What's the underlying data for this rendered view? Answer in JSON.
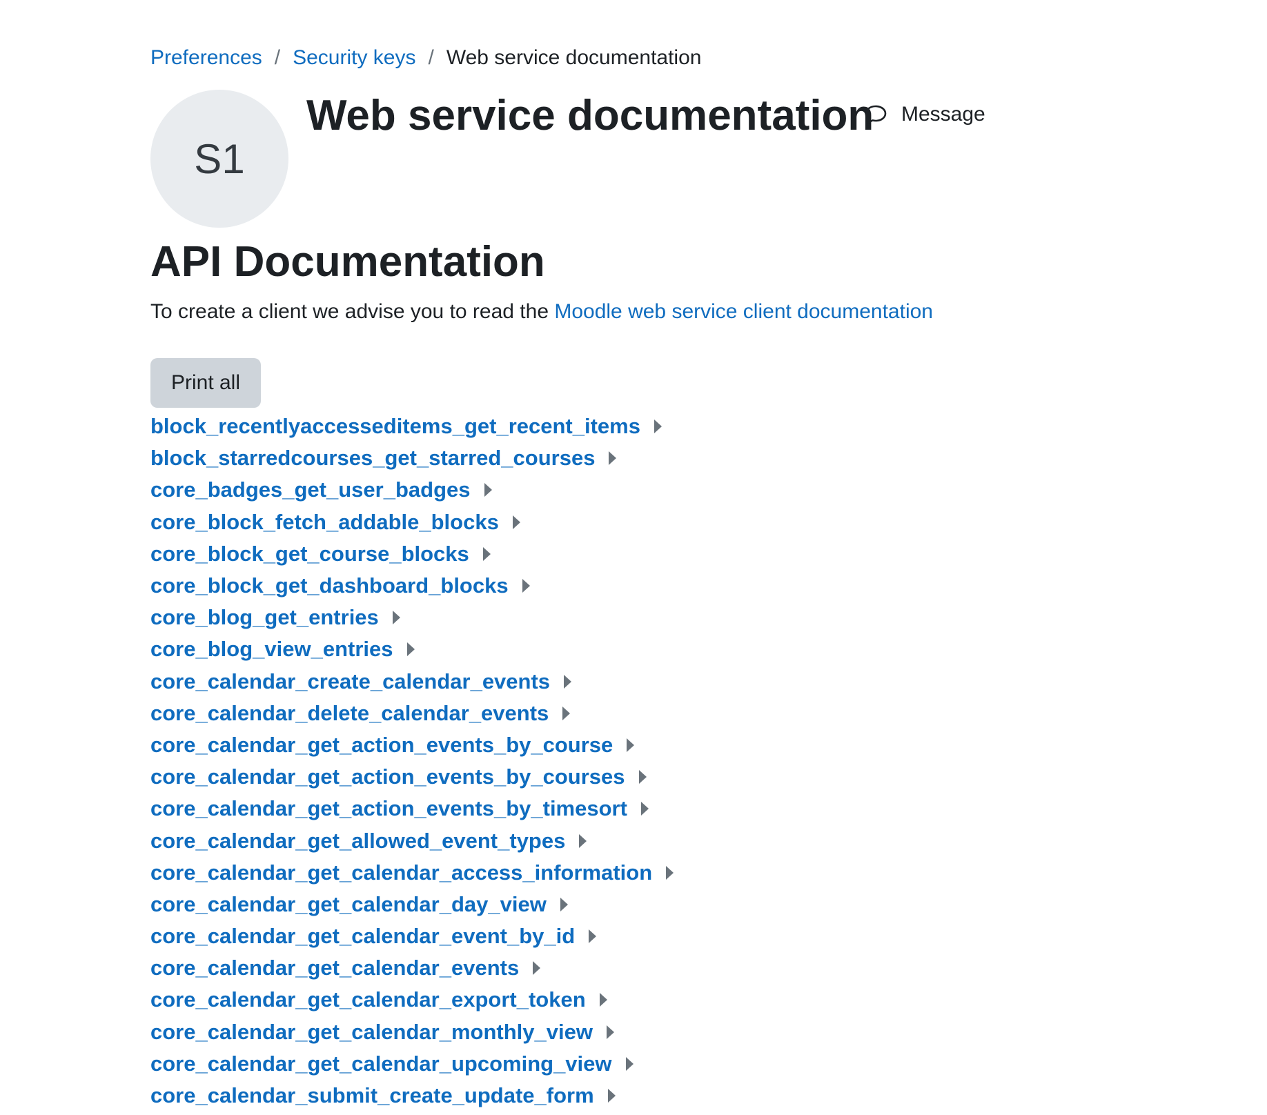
{
  "breadcrumb": {
    "items": [
      "Preferences",
      "Security keys"
    ],
    "separator": "/",
    "current": "Web service documentation"
  },
  "header": {
    "avatar_initials": "S1",
    "title": "Web service documentation",
    "message_label": "Message"
  },
  "main": {
    "heading": "API Documentation",
    "intro_text": "To create a client we advise you to read the ",
    "intro_link": "Moodle web service client documentation",
    "print_all_label": "Print all",
    "functions": [
      "block_recentlyaccesseditems_get_recent_items",
      "block_starredcourses_get_starred_courses",
      "core_badges_get_user_badges",
      "core_block_fetch_addable_blocks",
      "core_block_get_course_blocks",
      "core_block_get_dashboard_blocks",
      "core_blog_get_entries",
      "core_blog_view_entries",
      "core_calendar_create_calendar_events",
      "core_calendar_delete_calendar_events",
      "core_calendar_get_action_events_by_course",
      "core_calendar_get_action_events_by_courses",
      "core_calendar_get_action_events_by_timesort",
      "core_calendar_get_allowed_event_types",
      "core_calendar_get_calendar_access_information",
      "core_calendar_get_calendar_day_view",
      "core_calendar_get_calendar_event_by_id",
      "core_calendar_get_calendar_events",
      "core_calendar_get_calendar_export_token",
      "core_calendar_get_calendar_monthly_view",
      "core_calendar_get_calendar_upcoming_view",
      "core_calendar_submit_create_update_form"
    ],
    "expand_icon": "caret-right-icon"
  },
  "colors": {
    "link": "#0f6cbf",
    "text": "#1d2125",
    "avatar_bg": "#e9ecef",
    "button_bg": "#ced4da",
    "caret": "#6a737b"
  }
}
